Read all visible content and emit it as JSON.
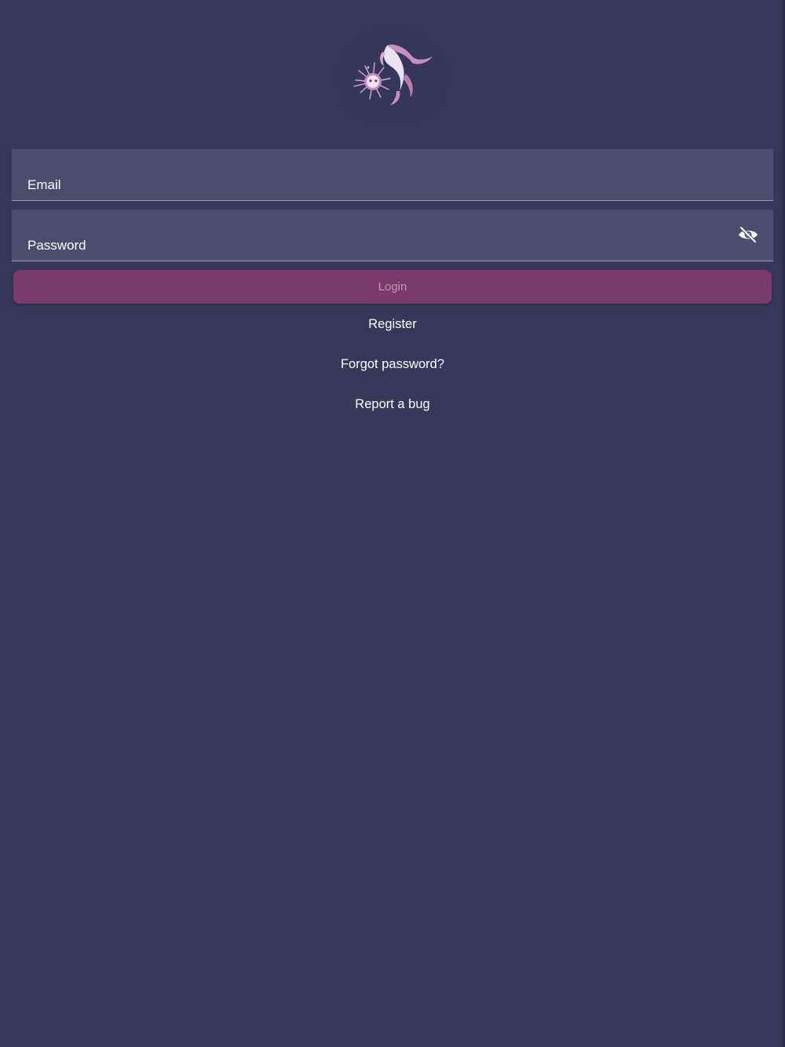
{
  "app": {
    "logo_icon": "fish-and-sea-urchin-logo",
    "colors": {
      "background": "#353859",
      "field_background": "#4a4d6b",
      "accent": "#7c3a6a",
      "accent_text": "#b99ab2",
      "text": "#ffffff"
    }
  },
  "form": {
    "email": {
      "label": "Email",
      "value": ""
    },
    "password": {
      "label": "Password",
      "value": "",
      "visibility_icon": "eye-off-icon"
    },
    "login_label": "Login"
  },
  "links": {
    "register": "Register",
    "forgot_password": "Forgot password?",
    "report_bug": "Report a bug"
  }
}
